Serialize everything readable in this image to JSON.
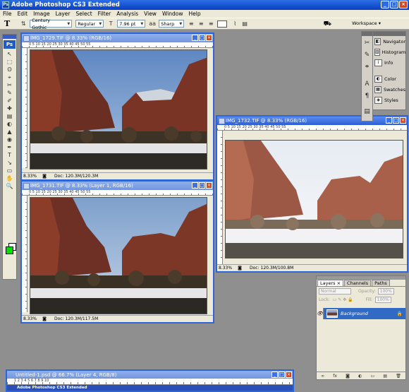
{
  "app": {
    "title": "Adobe Photoshop CS3 Extended",
    "icon_name": "photoshop-app-icon"
  },
  "window_buttons": {
    "minimize": "_",
    "maximize": "□",
    "close": "×"
  },
  "menu": [
    "File",
    "Edit",
    "Image",
    "Layer",
    "Select",
    "Filter",
    "Analysis",
    "View",
    "Window",
    "Help"
  ],
  "options": {
    "tool_glyph": "T",
    "font_family": "Century Gothic",
    "font_style": "Regular",
    "font_size": "7.96 pt",
    "aa_icon": "aa",
    "antialias": "Sharp",
    "workspace": "Workspace ▾"
  },
  "toolbox": {
    "logo": "Ps",
    "tools": [
      "↖",
      "⬚",
      "ʘ",
      "⌖",
      "✂",
      "✎",
      "✐",
      "✚",
      "▤",
      "◐",
      "▲",
      "◉",
      "✒",
      "T",
      "↘",
      "▭",
      "✋",
      "🔍"
    ]
  },
  "documents": [
    {
      "title": "IMG_1729.TIF @ 8.33% (RGB/16)",
      "zoom": "8.33%",
      "doc": "Doc: 120.3M/120.3M",
      "ruler": "0  5  10  15  20  25  30  35  40  45  50  55"
    },
    {
      "title": "IMG_1731.TIF @ 8.33% (Layer 1, RGB/16)",
      "zoom": "8.33%",
      "doc": "Doc: 120.3M/117.5M",
      "ruler": "0  5  10  15  20  25  30  35  40  45  50  55"
    },
    {
      "title": "IMG_1732.TIF @ 8.33% (RGB/16)",
      "zoom": "8.33%",
      "doc": "Doc: 120.3M/100.8M",
      "ruler": "0  5  10  15  20  25  30  35  40  45  50  55"
    },
    {
      "title": "Untitled-1.psd @ 66.7% (Layer 4, RGB/8)",
      "ruler": "1  2  3  4  5  6  7  8  9  10",
      "inner_title": "Adobe Photoshop CS3 Extended"
    }
  ],
  "dock": {
    "items": [
      "Navigator",
      "Histogram",
      "Info",
      "Color",
      "Swatches",
      "Styles"
    ]
  },
  "layers_panel": {
    "tabs": [
      "Layers ×",
      "Channels",
      "Paths"
    ],
    "blend_mode": "Normal",
    "opacity_label": "Opacity:",
    "opacity": "100%",
    "lock_label": "Lock:",
    "fill_label": "Fill:",
    "fill": "100%",
    "layer_name": "Background",
    "footer_icons": [
      "∞",
      "fx",
      "◙",
      "◐",
      "▭",
      "▤",
      "🗑"
    ]
  },
  "colors": {
    "foreground": "#00e000",
    "background": "#ffffff",
    "desktop": "#8f8f8f",
    "titlebar": "#0a3fbf"
  }
}
